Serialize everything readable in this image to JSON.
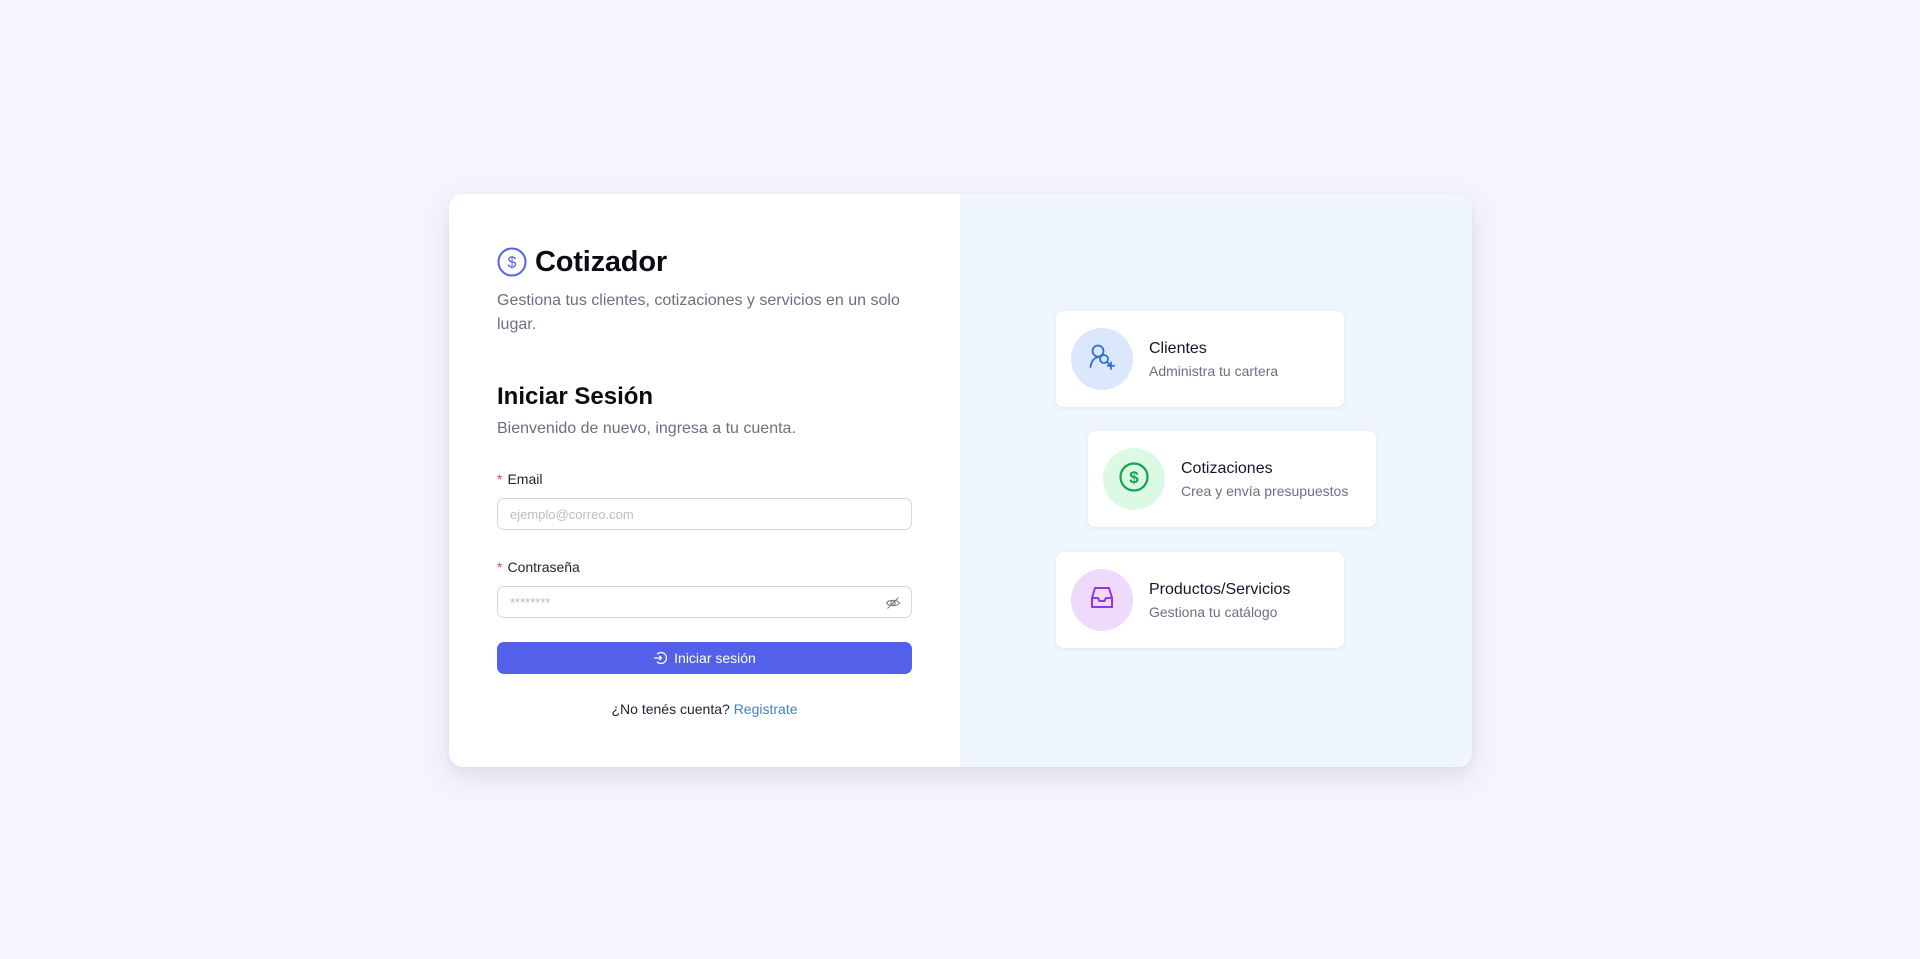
{
  "brand": {
    "title": "Cotizador",
    "subtitle": "Gestiona tus clientes, cotizaciones y servicios en un solo lugar.",
    "icon": "dollar-circle-icon"
  },
  "login": {
    "title": "Iniciar Sesión",
    "subtitle": "Bienvenido de nuevo, ingresa a tu cuenta.",
    "required_mark": "*",
    "email_label": "Email",
    "email_placeholder": "ejemplo@correo.com",
    "email_value": "",
    "password_label": "Contraseña",
    "password_placeholder": "********",
    "password_value": "",
    "submit_label": "Iniciar sesión",
    "register_prompt": "¿No tenés cuenta?",
    "register_link": "Registrate"
  },
  "features": [
    {
      "title": "Clientes",
      "description": "Administra tu cartera",
      "icon": "user-add-icon",
      "color": "#2f6fd6"
    },
    {
      "title": "Cotizaciones",
      "description": "Crea y envía presupuestos",
      "icon": "dollar-circle-icon",
      "color": "#16a34a"
    },
    {
      "title": "Productos/Servicios",
      "description": "Gestiona tu catálogo",
      "icon": "inbox-icon",
      "color": "#9333ea"
    }
  ],
  "colors": {
    "background": "#f5f5fe",
    "primary": "#5361ea",
    "link": "#3f80c8",
    "required": "#e5484d",
    "right_panel": "#f0f6fe"
  }
}
